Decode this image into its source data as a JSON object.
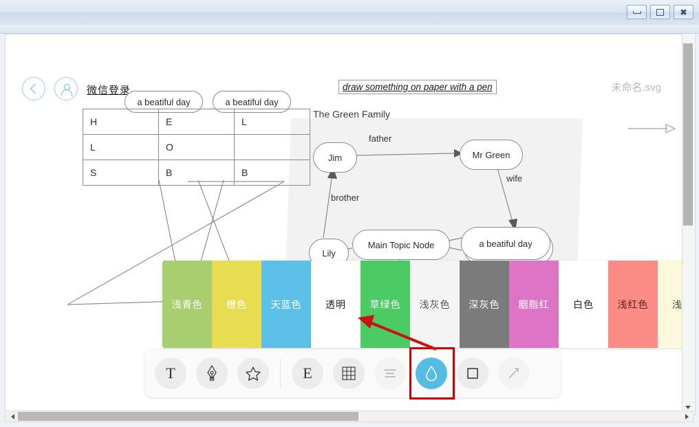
{
  "window": {
    "controls": [
      {
        "name": "minimize",
        "glyph": "minimize-icon"
      },
      {
        "name": "maximize",
        "glyph": "maximize-icon"
      },
      {
        "name": "close",
        "glyph": "close-icon"
      }
    ]
  },
  "header": {
    "back_label": "",
    "login_text": "微信登录",
    "file_name": "未命名.svg"
  },
  "canvas": {
    "note_text": "draw something on paper with a pen",
    "family_title": "The Green Family",
    "bubbles": [
      {
        "label": "a beatiful day"
      },
      {
        "label": "a beatiful day"
      }
    ],
    "table_rows": [
      [
        "H",
        "E",
        "L"
      ],
      [
        "L",
        "O",
        ""
      ],
      [
        "S",
        "B",
        "B"
      ]
    ],
    "nodes": {
      "jim": "Jim",
      "mr_green": "Mr Green",
      "lily": "Lily",
      "main_topic": "Main Topic Node",
      "beautiful_day": "a beatiful day"
    },
    "edge_labels": {
      "father": "father",
      "wife": "wife",
      "brother": "brother"
    }
  },
  "palette": {
    "swatches": [
      {
        "label": "浅青色",
        "color": "#a9ce6f",
        "text_color": "#ffffff"
      },
      {
        "label": "橙色",
        "color": "#e8dd52",
        "text_color": "#ffffff"
      },
      {
        "label": "天蓝色",
        "color": "#5cc0e8",
        "text_color": "#ffffff"
      },
      {
        "label": "透明",
        "color": "#ffffff",
        "text_color": "#222222"
      },
      {
        "label": "草绿色",
        "color": "#4cca64",
        "text_color": "#ffffff"
      },
      {
        "label": "浅灰色",
        "color": "#f4f4f4",
        "text_color": "#555555"
      },
      {
        "label": "深灰色",
        "color": "#7b7b7b",
        "text_color": "#ffffff"
      },
      {
        "label": "胭脂红",
        "color": "#dd74c6",
        "text_color": "#ffffff"
      },
      {
        "label": "白色",
        "color": "#ffffff",
        "text_color": "#222222"
      },
      {
        "label": "浅红色",
        "color": "#fb8b85",
        "text_color": "#5a2020"
      },
      {
        "label": "浅米",
        "color": "#fcf8dc",
        "text_color": "#444444"
      }
    ]
  },
  "toolbar": {
    "tools": [
      {
        "name": "text-tool",
        "label": "T",
        "icon": "text-icon",
        "state": "normal"
      },
      {
        "name": "pen-tool",
        "label": "",
        "icon": "pen-nib-icon",
        "state": "normal"
      },
      {
        "name": "shape-tool",
        "label": "",
        "icon": "star-icon",
        "state": "normal"
      },
      {
        "name": "element-tool",
        "label": "E",
        "icon": "element-icon",
        "state": "normal"
      },
      {
        "name": "table-tool",
        "label": "",
        "icon": "grid-icon",
        "state": "normal"
      },
      {
        "name": "align-tool",
        "label": "",
        "icon": "align-icon",
        "state": "disabled"
      },
      {
        "name": "fill-color-tool",
        "label": "",
        "icon": "water-drop-icon",
        "state": "active"
      },
      {
        "name": "rectangle-tool",
        "label": "",
        "icon": "square-icon",
        "state": "normal"
      },
      {
        "name": "line-tool",
        "label": "",
        "icon": "arrow-line-icon",
        "state": "disabled"
      }
    ],
    "accent_color": "#55bde4",
    "highlight_color": "#cc0000"
  },
  "scrollbars": {
    "vertical_thumb_pct": 50,
    "horizontal_thumb_pct": 50
  }
}
